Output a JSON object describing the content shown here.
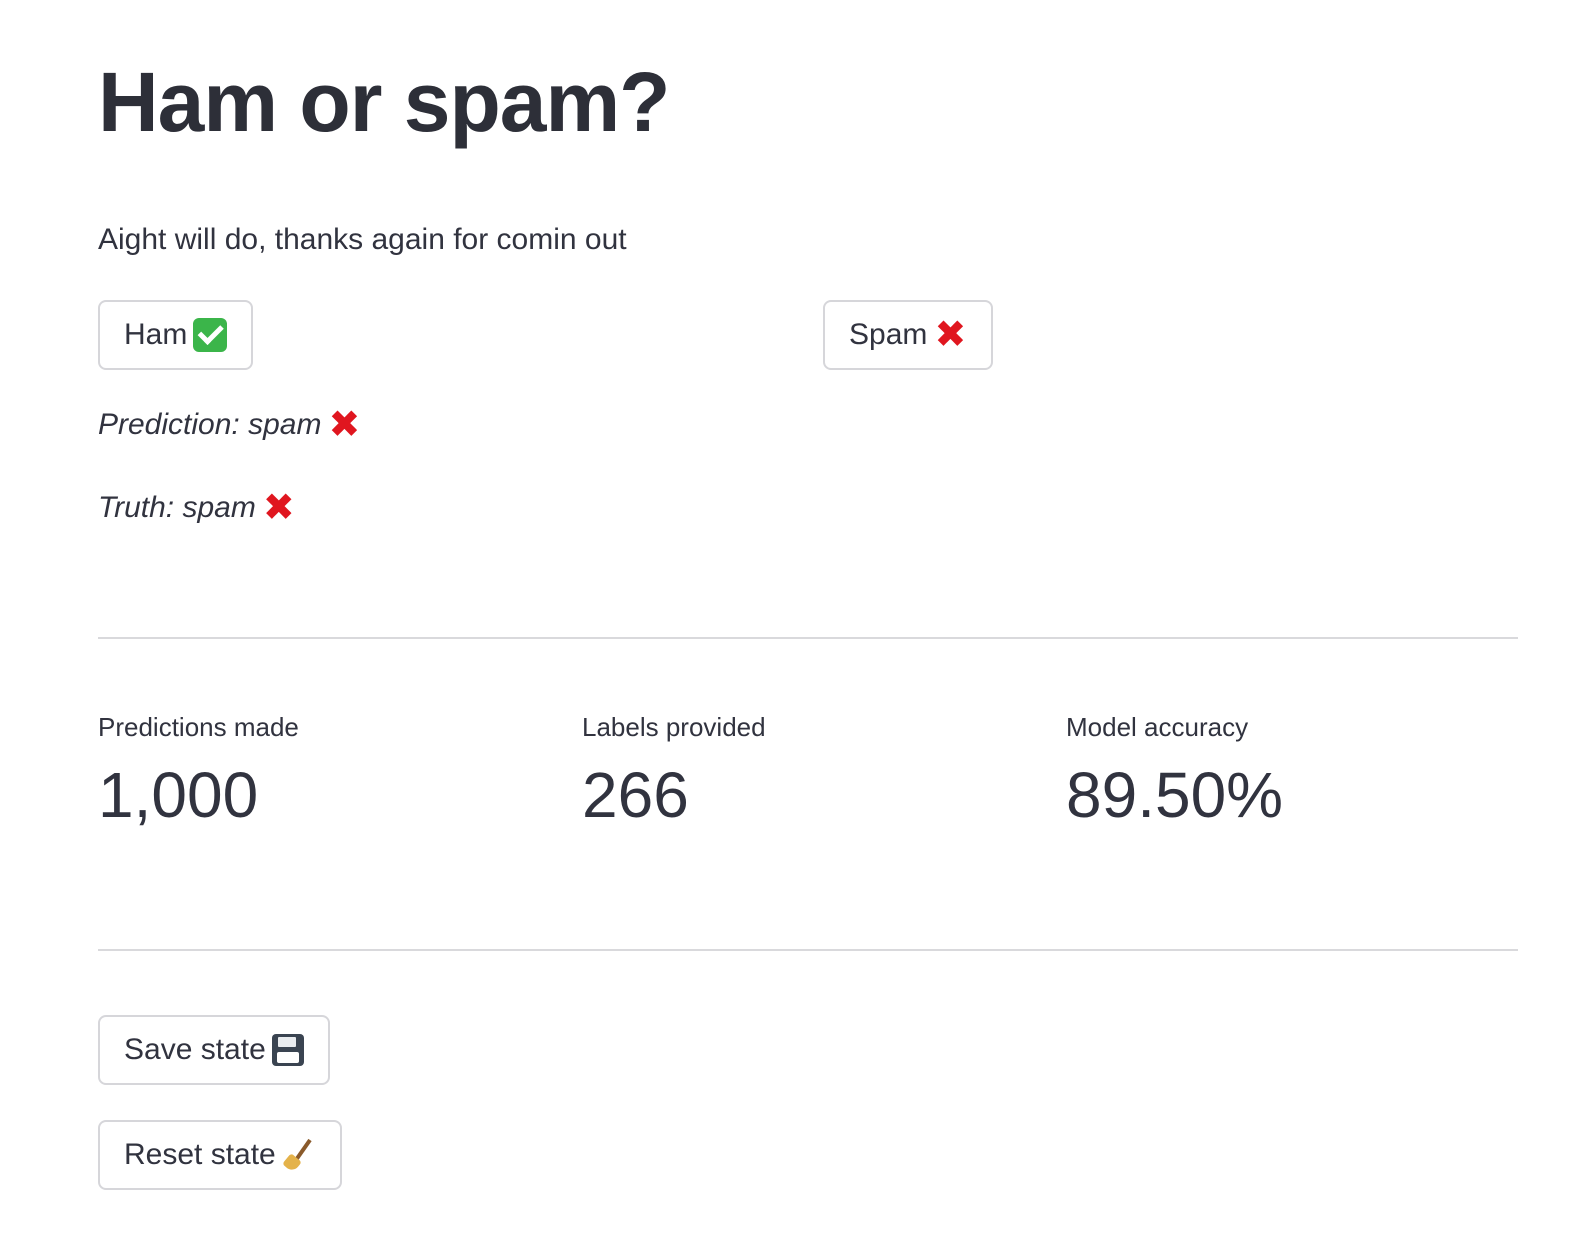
{
  "page": {
    "title": "Ham or spam?",
    "message": "Aight will do, thanks again for comin out"
  },
  "buttons": {
    "ham_label": "Ham",
    "ham_icon": "check-mark-icon",
    "spam_label": "Spam",
    "spam_icon": "cross-mark-icon",
    "save_label": "Save state",
    "save_icon": "floppy-disk-icon",
    "reset_label": "Reset state",
    "reset_icon": "broom-icon"
  },
  "result": {
    "prediction_text": "Prediction: spam",
    "prediction_icon": "cross-mark-icon",
    "truth_text": "Truth: spam",
    "truth_icon": "cross-mark-icon"
  },
  "metrics": [
    {
      "label": "Predictions made",
      "value": "1,000"
    },
    {
      "label": "Labels provided",
      "value": "266"
    },
    {
      "label": "Model accuracy",
      "value": "89.50%"
    }
  ],
  "colors": {
    "text": "#31333f",
    "check_green": "#3bb54a",
    "cross_red": "#e0161f",
    "border": "#d6d6da"
  }
}
